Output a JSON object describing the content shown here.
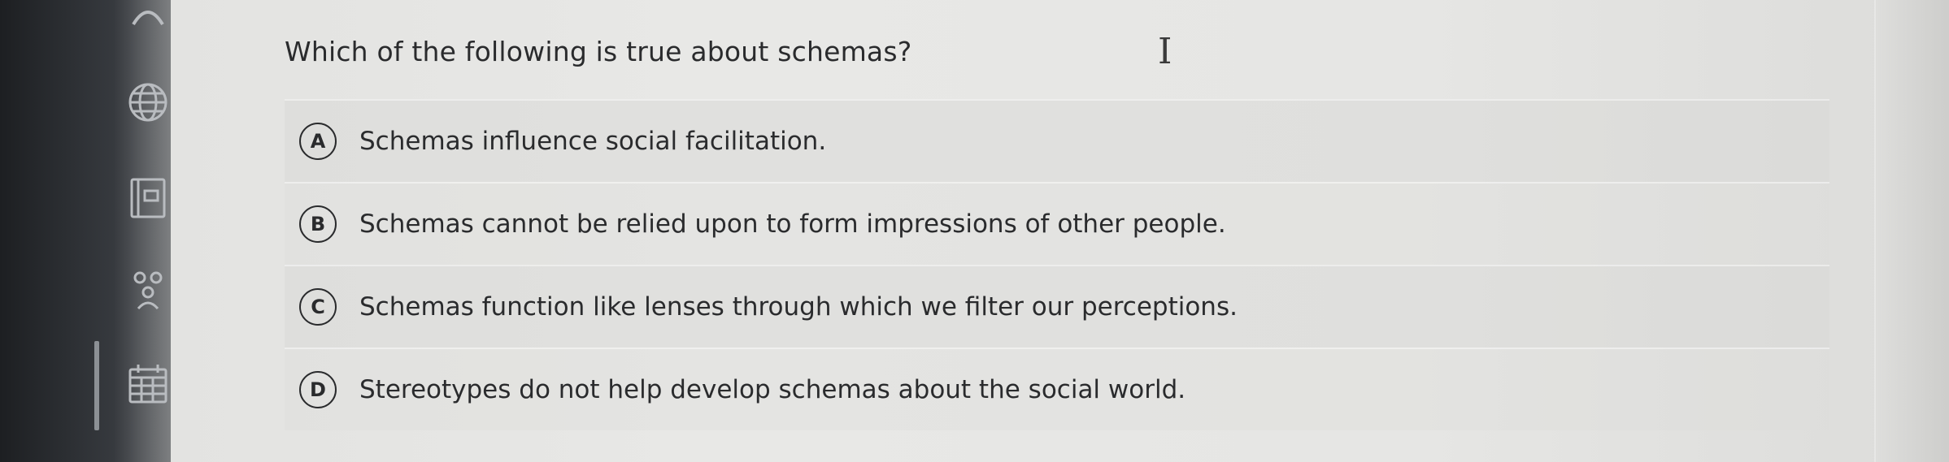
{
  "question": {
    "text": "Which of the following is true about schemas?"
  },
  "choices": [
    {
      "letter": "A",
      "text": "Schemas influence social facilitation."
    },
    {
      "letter": "B",
      "text": "Schemas cannot be relied upon to form impressions of other people."
    },
    {
      "letter": "C",
      "text": "Schemas function like lenses through which we filter our perceptions."
    },
    {
      "letter": "D",
      "text": "Stereotypes do not help develop schemas about the social world."
    }
  ],
  "sidebar": {
    "icons": [
      "globe-icon",
      "book-icon",
      "people-icon",
      "calendar-icon"
    ]
  },
  "cursor": {
    "glyph": "I"
  },
  "colors": {
    "sidebar": "#2c2f33",
    "background": "#e6e6e4",
    "text": "#2a2b2d"
  }
}
